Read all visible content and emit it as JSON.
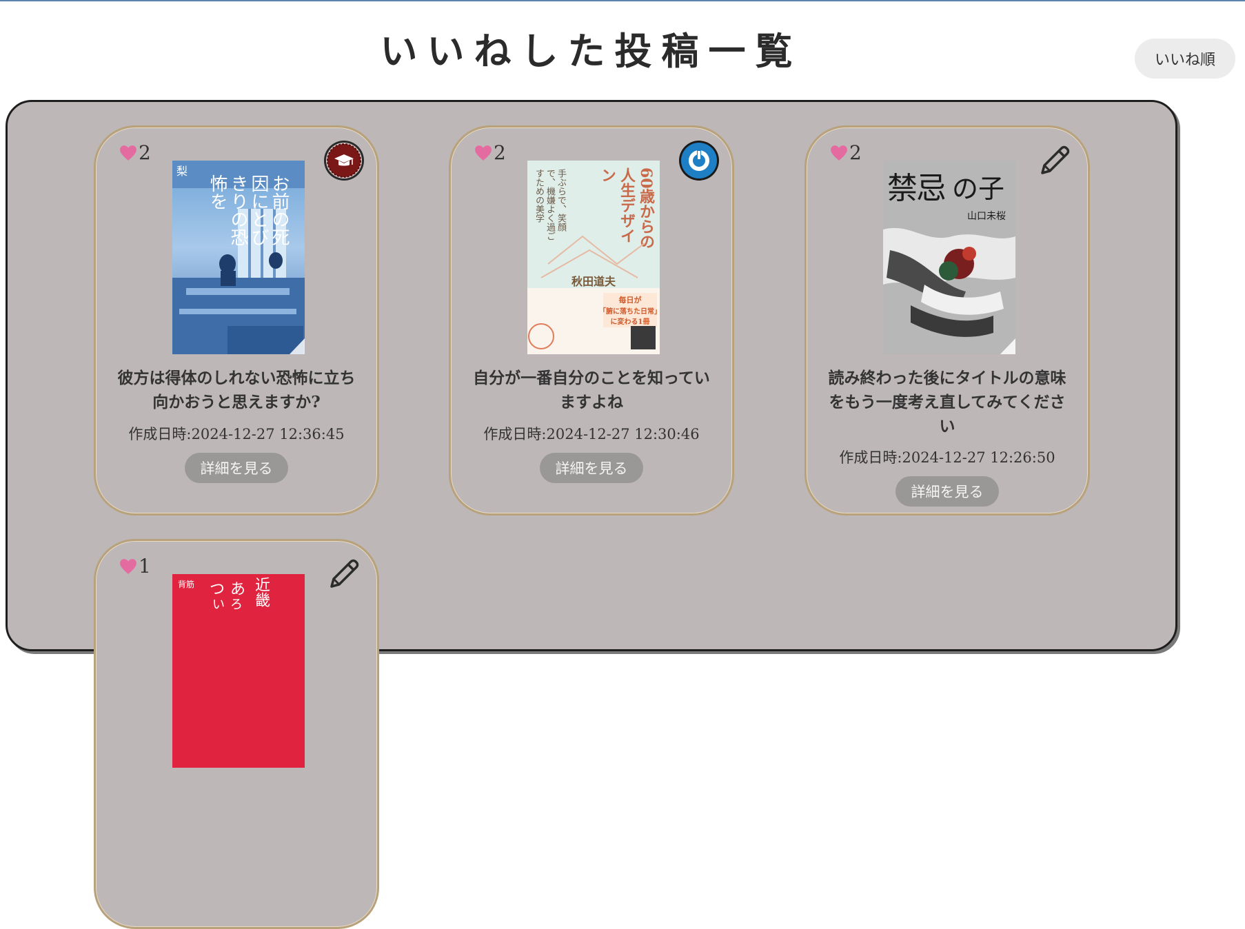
{
  "page": {
    "title": "いいねした投稿一覧",
    "sort_label": "いいね順"
  },
  "cards": [
    {
      "likes": "2",
      "badge": "graduation-cap-badge",
      "title": "彼方は得体のしれない恐怖に立ち向かおうと思えますか?",
      "date": "作成日時:2024-12-27 12:36:45",
      "button": "詳細を見る",
      "cover": {
        "text_a": "梨",
        "text_b": "お前の死因にとびきりの恐怖を"
      }
    },
    {
      "likes": "2",
      "badge": "power-circle-badge",
      "title": "自分が一番自分のことを知っていますよね",
      "date": "作成日時:2024-12-27 12:30:46",
      "button": "詳細を見る",
      "cover": {
        "title": "60歳からの人生デザイン",
        "subtitle": "手ぶらで、笑顔で、機嫌よく過ごすための美学",
        "author": "秋田道夫",
        "band_1": "毎日が",
        "band_2": "「腑に落ちた日常」",
        "band_3": "に変わる1冊"
      }
    },
    {
      "likes": "2",
      "badge": "pencil-icon",
      "title": "読み終わった後にタイトルの意味をもう一度考え直してみてください",
      "date": "作成日時:2024-12-27 12:26:50",
      "button": "詳細を見る",
      "cover": {
        "title_1": "禁忌",
        "title_2": "の子",
        "author": "山口未桜"
      }
    },
    {
      "likes": "1",
      "badge": "pencil-icon",
      "cover": {
        "label": "背筋",
        "text_1": "近畿",
        "text_2": "つ",
        "text_3": "あ",
        "text_4": "い",
        "text_5": "ろ"
      }
    }
  ],
  "colors": {
    "panel": "#beb7b7",
    "card_border": "#b8a27c",
    "heart": "#e36b9f",
    "button": "#9a9896",
    "badge_cap": "#7a1717",
    "badge_power": "#1e7fc4"
  }
}
